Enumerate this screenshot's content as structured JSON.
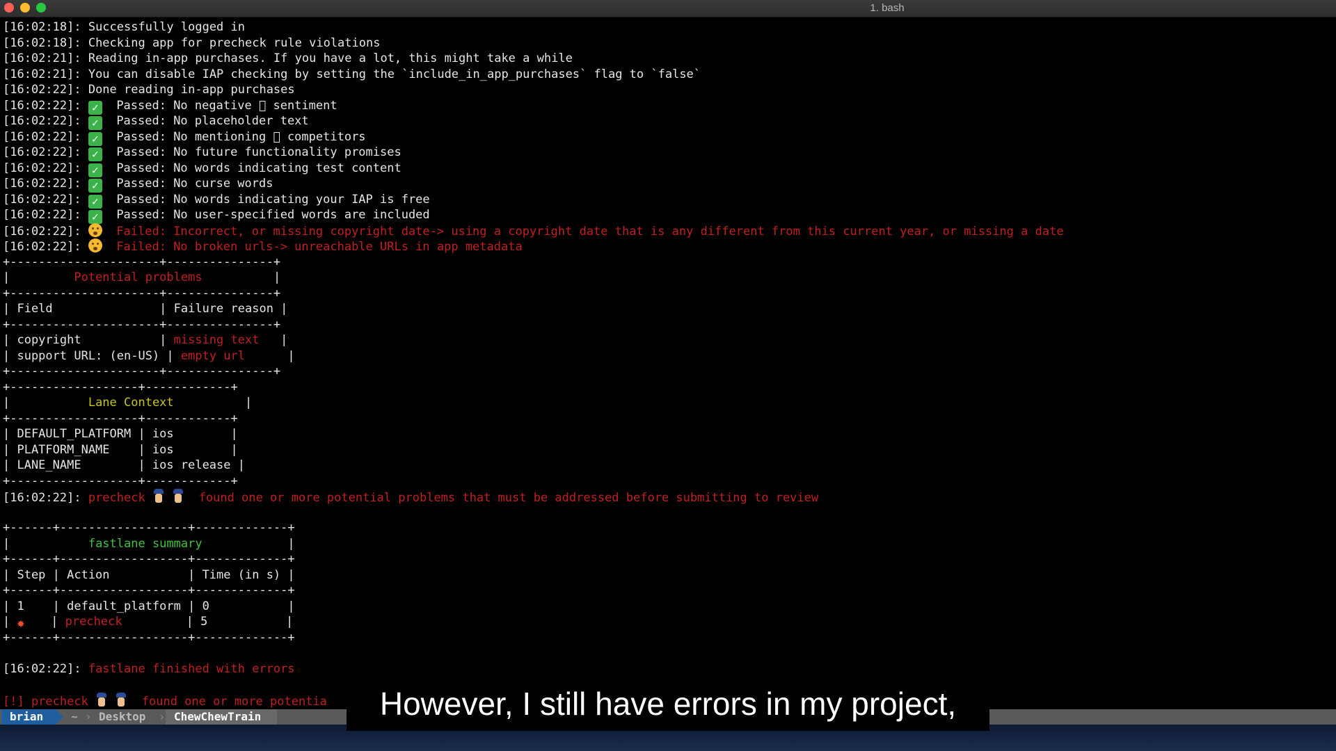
{
  "window": {
    "title": "1. bash"
  },
  "log": [
    {
      "ts": "[16:02:18]:",
      "text": " Successfully logged in"
    },
    {
      "ts": "[16:02:18]:",
      "text": " Checking app for precheck rule violations"
    },
    {
      "ts": "[16:02:21]:",
      "text": " Reading in-app purchases. If you have a lot, this might take a while"
    },
    {
      "ts": "[16:02:21]:",
      "text": " You can disable IAP checking by setting the `include_in_app_purchases` flag to `false`"
    },
    {
      "ts": "[16:02:22]:",
      "text": " Done reading in-app purchases"
    }
  ],
  "passed": [
    {
      "ts": "[16:02:22]:",
      "text": "  Passed: No negative  sentiment"
    },
    {
      "ts": "[16:02:22]:",
      "text": "  Passed: No placeholder text"
    },
    {
      "ts": "[16:02:22]:",
      "text": "  Passed: No mentioning  competitors"
    },
    {
      "ts": "[16:02:22]:",
      "text": "  Passed: No future functionality promises"
    },
    {
      "ts": "[16:02:22]:",
      "text": "  Passed: No words indicating test content"
    },
    {
      "ts": "[16:02:22]:",
      "text": "  Passed: No curse words"
    },
    {
      "ts": "[16:02:22]:",
      "text": "  Passed: No words indicating your IAP is free"
    },
    {
      "ts": "[16:02:22]:",
      "text": "  Passed: No user-specified words are included"
    }
  ],
  "failed": [
    {
      "ts": "[16:02:22]:",
      "text": "  Failed: Incorrect, or missing copyright date-> using a copyright date that is any different from this current year, or missing a date"
    },
    {
      "ts": "[16:02:22]:",
      "text": "  Failed: No broken urls-> unreachable URLs in app metadata"
    }
  ],
  "problems_table": {
    "border": "+---------------------+---------------+",
    "title_pre": "|         ",
    "title": "Potential problems",
    "title_post": "          |",
    "header": "| Field               | Failure reason |",
    "rows": [
      {
        "pre": "| copyright           | ",
        "val": "missing text",
        "post": "   |"
      },
      {
        "pre": "| support URL: (en-US) | ",
        "val": "empty url",
        "post": "      |"
      }
    ]
  },
  "lane_table": {
    "border": "+------------------+------------+",
    "title_pre": "|           ",
    "title": "Lane Context",
    "title_post": "          |",
    "rows": [
      "| DEFAULT_PLATFORM | ios        |",
      "| PLATFORM_NAME    | ios        |",
      "| LANE_NAME        | ios release |"
    ]
  },
  "precheck_line": {
    "ts": "[16:02:22]:",
    "cmd": " precheck",
    "msg": "  found one or more potential problems that must be addressed before submitting to review"
  },
  "summary_table": {
    "border": "+------+------------------+-------------+",
    "title_pre": "|           ",
    "title": "fastlane summary",
    "title_post": "            |",
    "header": "| Step | Action           | Time (in s) |",
    "row1": "| 1    | default_platform | 0           |",
    "row2_pre": "| ",
    "row2_mid": "   | ",
    "row2_action": "precheck",
    "row2_post": "         | 5           |"
  },
  "finish_line": {
    "ts": "[16:02:22]:",
    "msg": " fastlane finished with errors"
  },
  "bottom_line": {
    "prefix": "[!] precheck",
    "msg": "  found one or more potentia"
  },
  "statusbar": {
    "user": "brian",
    "home": "~",
    "dir": "Desktop",
    "repo": "ChewChewTrain"
  },
  "subtitle": "However, I still have errors in my project,"
}
